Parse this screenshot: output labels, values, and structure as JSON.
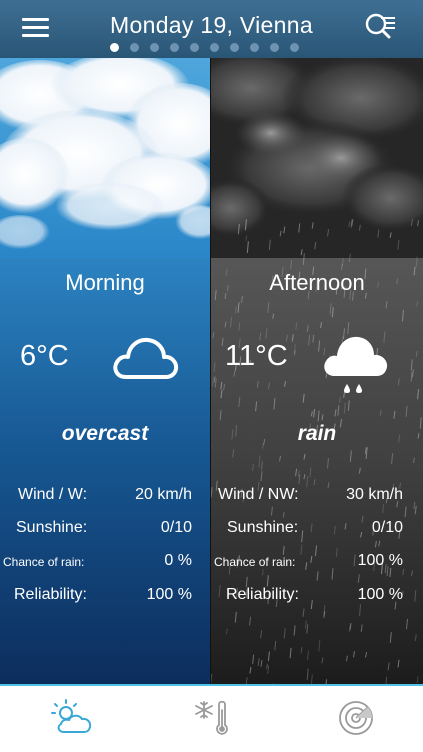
{
  "header": {
    "title": "Monday 19, Vienna",
    "page_count": 10,
    "active_page": 1
  },
  "morning": {
    "period": "Morning",
    "temperature": "6°C",
    "condition": "overcast",
    "icon": "cloud-icon",
    "rows": [
      {
        "label": "Wind / W:",
        "value": "20 km/h"
      },
      {
        "label": "Sunshine:",
        "value": "0/10"
      },
      {
        "label": "Chance of rain:",
        "value": "0 %"
      },
      {
        "label": "Reliability:",
        "value": "100 %"
      }
    ]
  },
  "afternoon": {
    "period": "Afternoon",
    "temperature": "11°C",
    "condition": "rain",
    "icon": "rain-cloud-icon",
    "rows": [
      {
        "label": "Wind / NW:",
        "value": "30 km/h"
      },
      {
        "label": "Sunshine:",
        "value": "0/10"
      },
      {
        "label": "Chance of rain:",
        "value": "100 %"
      },
      {
        "label": "Reliability:",
        "value": "100 %"
      }
    ]
  },
  "tabs": [
    {
      "icon": "partly-cloudy-icon",
      "active": true
    },
    {
      "icon": "snow-thermometer-icon",
      "active": false
    },
    {
      "icon": "radar-icon",
      "active": false
    }
  ],
  "colors": {
    "header": "#2f5f82",
    "accent": "#4fc3e6",
    "tab_active": "#39a8d6",
    "tab_inactive": "#9a9a9a"
  }
}
